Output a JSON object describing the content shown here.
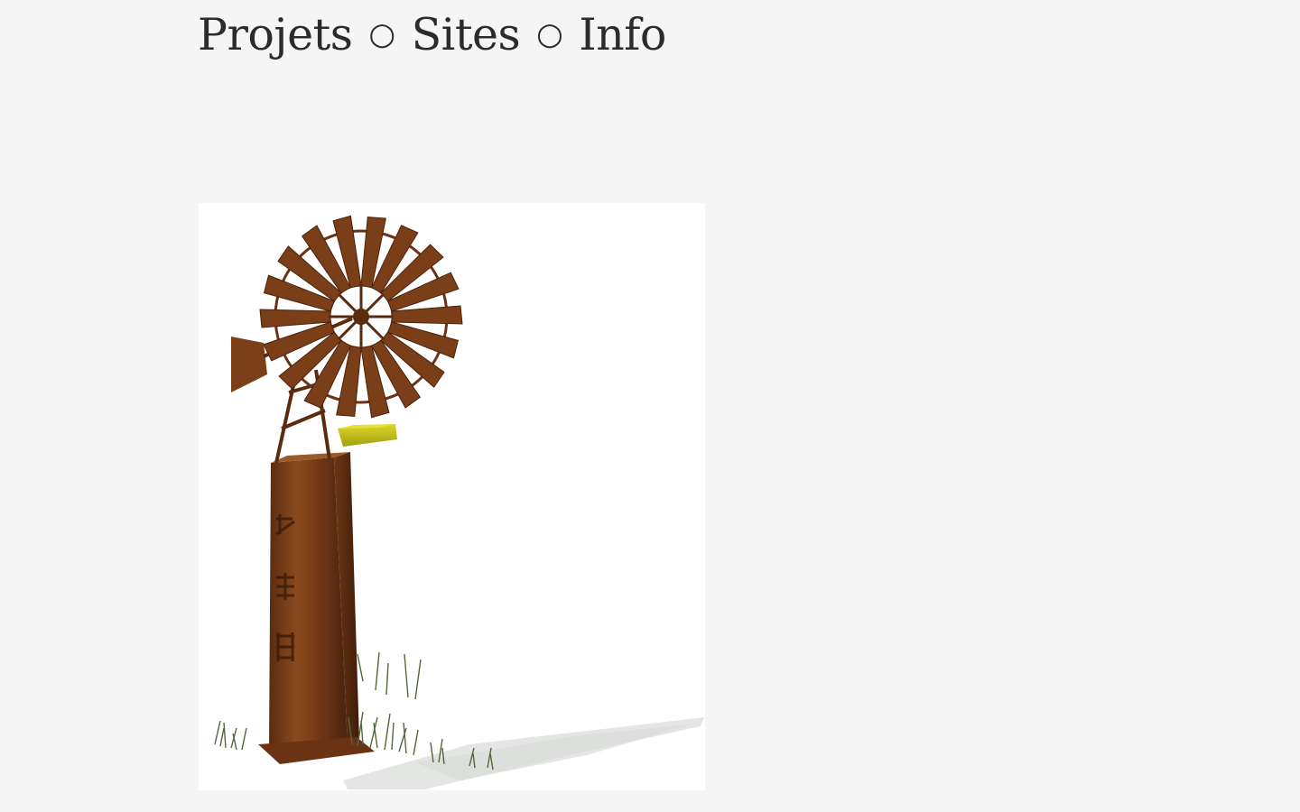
{
  "nav": {
    "items": [
      "Projets",
      "Sites",
      "Info"
    ],
    "separator": "○"
  },
  "artwork": {
    "subject": "rusted-windmill-sculpture",
    "colors": {
      "rust": "#7a3f18",
      "rust_dark": "#4e260f",
      "rust_light": "#9a5a2a",
      "yellow": "#c8c41a",
      "grass": "#5d6b3a",
      "shadow": "#e3e5e3"
    }
  }
}
